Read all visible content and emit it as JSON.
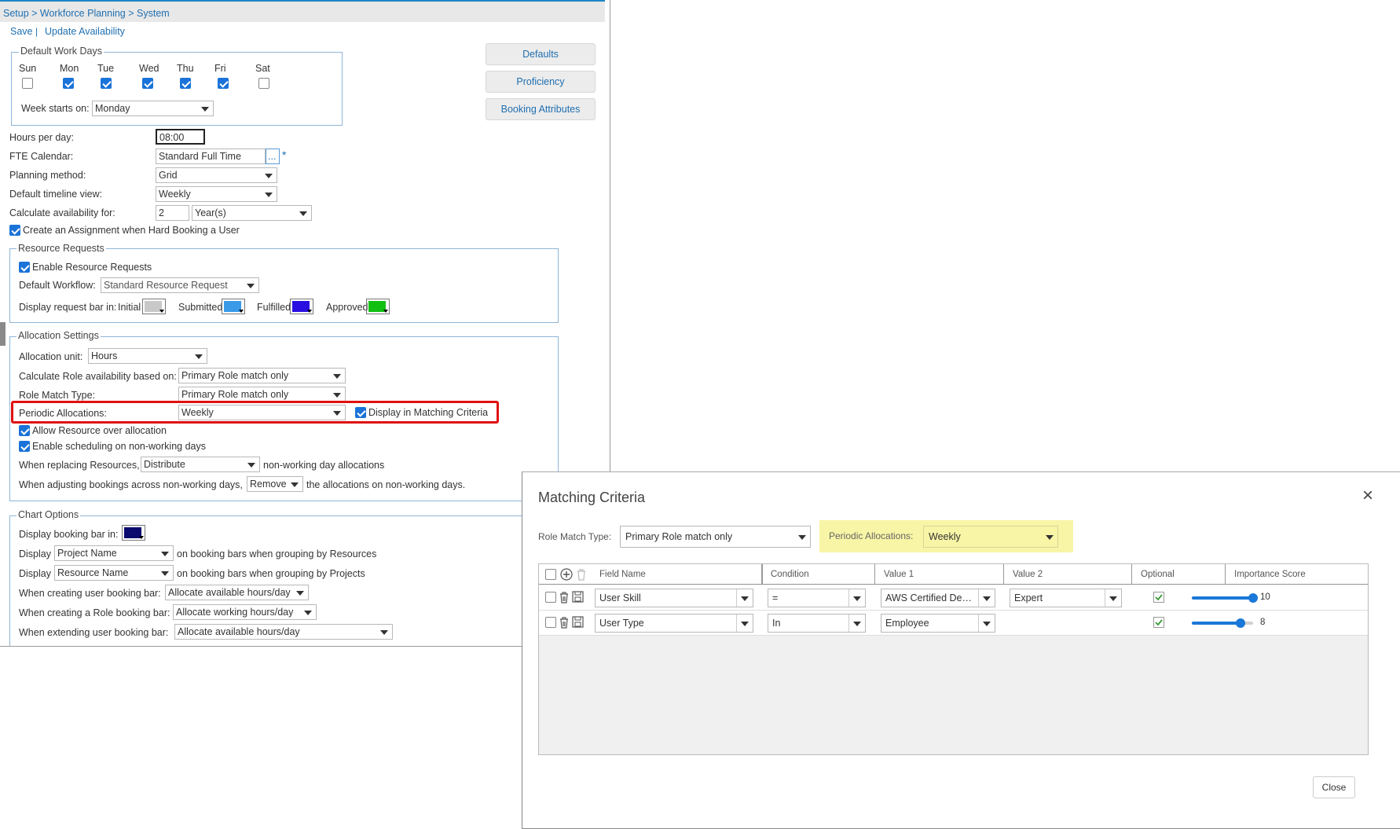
{
  "breadcrumb": "Setup > Workforce Planning > System",
  "toolbar": {
    "save": "Save",
    "separator": "|",
    "update": "Update Availability"
  },
  "side_buttons": {
    "defaults": "Defaults",
    "proficiency": "Proficiency",
    "booking_attributes": "Booking Attributes"
  },
  "work_days": {
    "legend": "Default Work Days",
    "days": [
      {
        "label": "Sun",
        "checked": false
      },
      {
        "label": "Mon",
        "checked": true
      },
      {
        "label": "Tue",
        "checked": true
      },
      {
        "label": "Wed",
        "checked": true
      },
      {
        "label": "Thu",
        "checked": true
      },
      {
        "label": "Fri",
        "checked": true
      },
      {
        "label": "Sat",
        "checked": false
      }
    ],
    "week_starts_label": "Week starts on:",
    "week_starts_value": "Monday"
  },
  "general": {
    "hours_label": "Hours per day:",
    "hours_value": "08:00",
    "fte_label": "FTE Calendar:",
    "fte_value": "Standard Full Time",
    "fte_button": "...",
    "fte_required": "*",
    "planning_label": "Planning method:",
    "planning_value": "Grid",
    "timeline_label": "Default timeline view:",
    "timeline_value": "Weekly",
    "calc_label": "Calculate availability for:",
    "calc_number": "2",
    "calc_unit": "Year(s)",
    "create_assignment_label": "Create an Assignment when Hard Booking a User"
  },
  "resource_requests": {
    "legend": "Resource Requests",
    "enable_label": "Enable Resource Requests",
    "workflow_label": "Default Workflow:",
    "workflow_value": "Standard Resource Request",
    "display_label": "Display request bar in:",
    "colors": [
      {
        "label": "Initial",
        "color": "#c8c8c8"
      },
      {
        "label": "Submitted",
        "color": "#3a9ae8"
      },
      {
        "label": "Fulfilled",
        "color": "#2a10e0"
      },
      {
        "label": "Approved",
        "color": "#12c012"
      }
    ]
  },
  "allocation": {
    "legend": "Allocation Settings",
    "unit_label": "Allocation unit:",
    "unit_value": "Hours",
    "calc_role_label": "Calculate Role availability based on:",
    "calc_role_value": "Primary Role match only",
    "role_match_label": "Role Match Type:",
    "role_match_value": "Primary Role match only",
    "periodic_label": "Periodic Allocations:",
    "periodic_value": "Weekly",
    "display_matching_label": "Display in Matching Criteria",
    "over_alloc_label": "Allow Resource over allocation",
    "non_working_label": "Enable scheduling on non-working days",
    "replacing_prefix": "When replacing Resources,",
    "replacing_value": "Distribute",
    "replacing_suffix": "non-working day allocations",
    "adjusting_prefix": "When adjusting bookings across non-working days,",
    "adjusting_value": "Remove",
    "adjusting_suffix": "the allocations on non-working days."
  },
  "chart_options": {
    "legend": "Chart Options",
    "booking_bar_label": "Display booking bar in:",
    "booking_bar_color": "#0a0a6e",
    "display_word": "Display",
    "group_res_value": "Project Name",
    "group_res_suffix": "on booking bars when grouping by Resources",
    "group_proj_value": "Resource Name",
    "group_proj_suffix": "on booking bars when grouping by Projects",
    "user_bar_label": "When creating user booking bar:",
    "user_bar_value": "Allocate available hours/day",
    "role_bar_label": "When creating a Role booking bar:",
    "role_bar_value": "Allocate working hours/day",
    "extend_label": "When extending user booking bar:",
    "extend_value": "Allocate available hours/day"
  },
  "modal": {
    "title": "Matching Criteria",
    "close_x": "×",
    "role_match_label": "Role Match Type:",
    "role_match_value": "Primary Role match only",
    "periodic_label": "Periodic Allocations:",
    "periodic_value": "Weekly",
    "columns": [
      "Field Name",
      "Condition",
      "Value 1",
      "Value 2",
      "Optional",
      "Importance Score"
    ],
    "rows": [
      {
        "field": "User Skill",
        "condition": "=",
        "value1": "AWS Certified Develop...",
        "value2": "Expert",
        "optional": true,
        "score": "10",
        "score_fraction": 1.0
      },
      {
        "field": "User Type",
        "condition": "In",
        "value1": "Employee",
        "value2": "",
        "optional": true,
        "score": "8",
        "score_fraction": 0.8
      }
    ],
    "close_button": "Close"
  },
  "colors": {
    "link": "#1f6fb0",
    "highlight_red": "#e01010",
    "highlight_yellow": "#f8f5a6",
    "check_blue": "#1a73d8",
    "slider_blue": "#1a78d8"
  }
}
